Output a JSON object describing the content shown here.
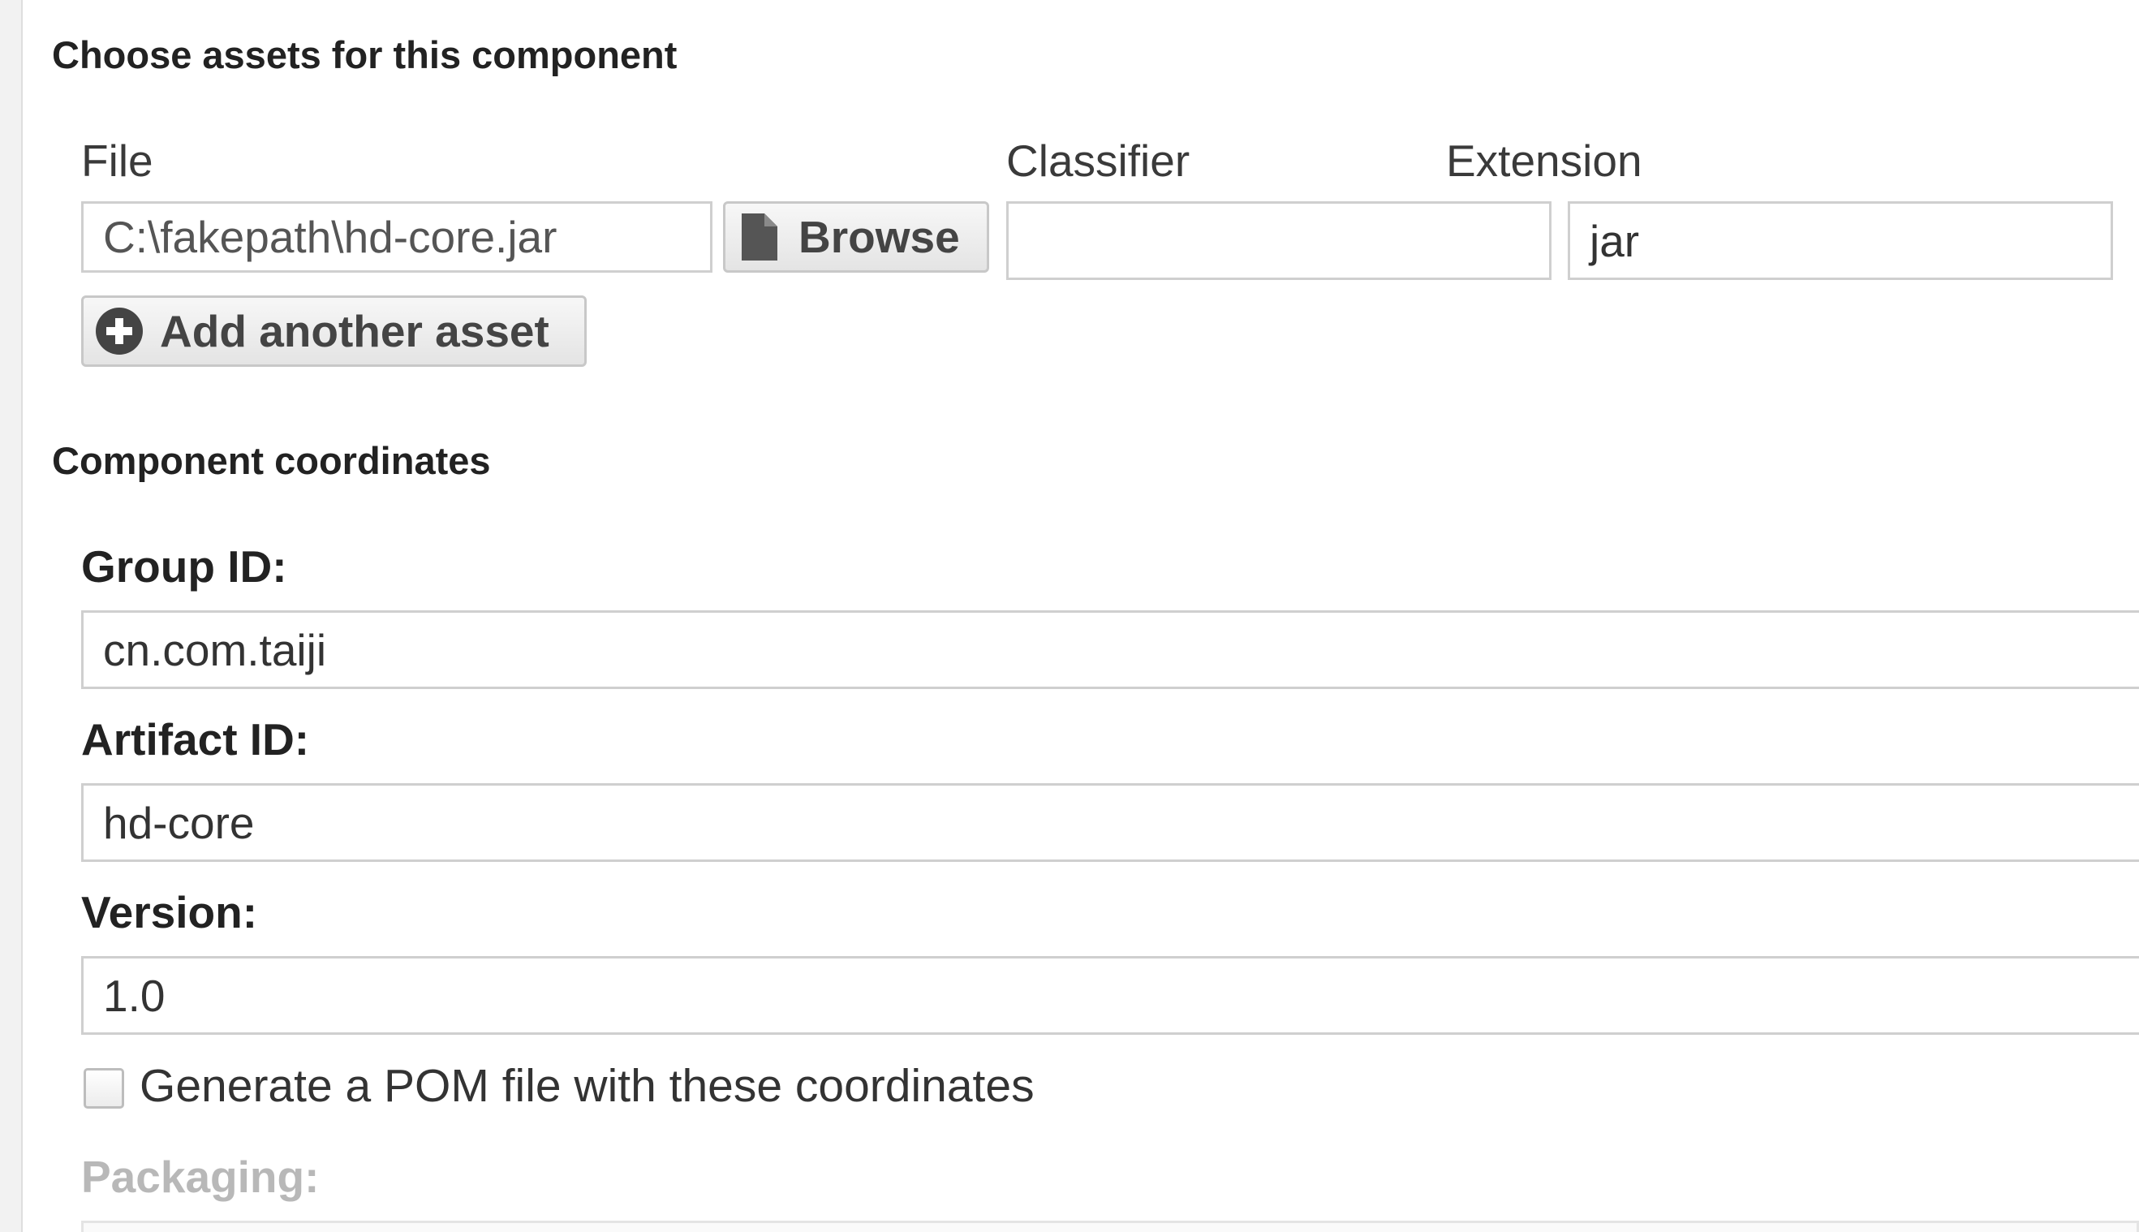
{
  "assets": {
    "section_title": "Choose assets for this component",
    "headers": {
      "file": "File",
      "classifier": "Classifier",
      "extension": "Extension"
    },
    "file_value": "C:\\fakepath\\hd-core.jar",
    "browse_label": "Browse",
    "classifier_value": "",
    "extension_value": "jar",
    "add_asset_label": "Add another asset",
    "icons": {
      "browse": "file-icon",
      "add": "plus-circle-icon"
    }
  },
  "coordinates": {
    "section_title": "Component coordinates",
    "group_id_label": "Group ID:",
    "group_id_value": "cn.com.taiji",
    "artifact_id_label": "Artifact ID:",
    "artifact_id_value": "hd-core",
    "version_label": "Version:",
    "version_value": "1.0",
    "generate_pom_label": "Generate a POM file with these coordinates",
    "generate_pom_checked": false,
    "packaging_label": "Packaging:"
  }
}
